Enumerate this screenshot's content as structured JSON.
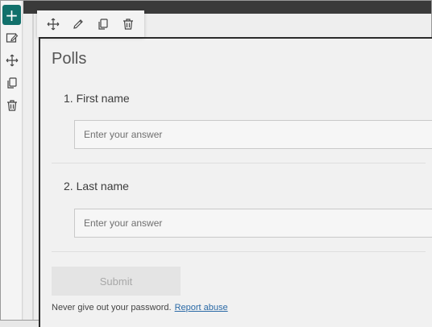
{
  "rail": {
    "add_glyph": "+",
    "icons": [
      "plus-icon",
      "edit-section-icon",
      "move-icon",
      "duplicate-icon",
      "delete-icon"
    ]
  },
  "toolbar": {
    "icons": [
      "move-icon",
      "edit-icon",
      "duplicate-icon",
      "delete-icon"
    ]
  },
  "poll": {
    "title": "Polls",
    "questions": [
      {
        "label": "1. First name",
        "placeholder": "Enter your answer"
      },
      {
        "label": "2. Last name",
        "placeholder": "Enter your answer"
      }
    ],
    "submit_label": "Submit",
    "footer_text": "Never give out your password.",
    "footer_link": "Report abuse"
  },
  "colors": {
    "accent": "#11706b",
    "link": "#2b6aa6"
  }
}
